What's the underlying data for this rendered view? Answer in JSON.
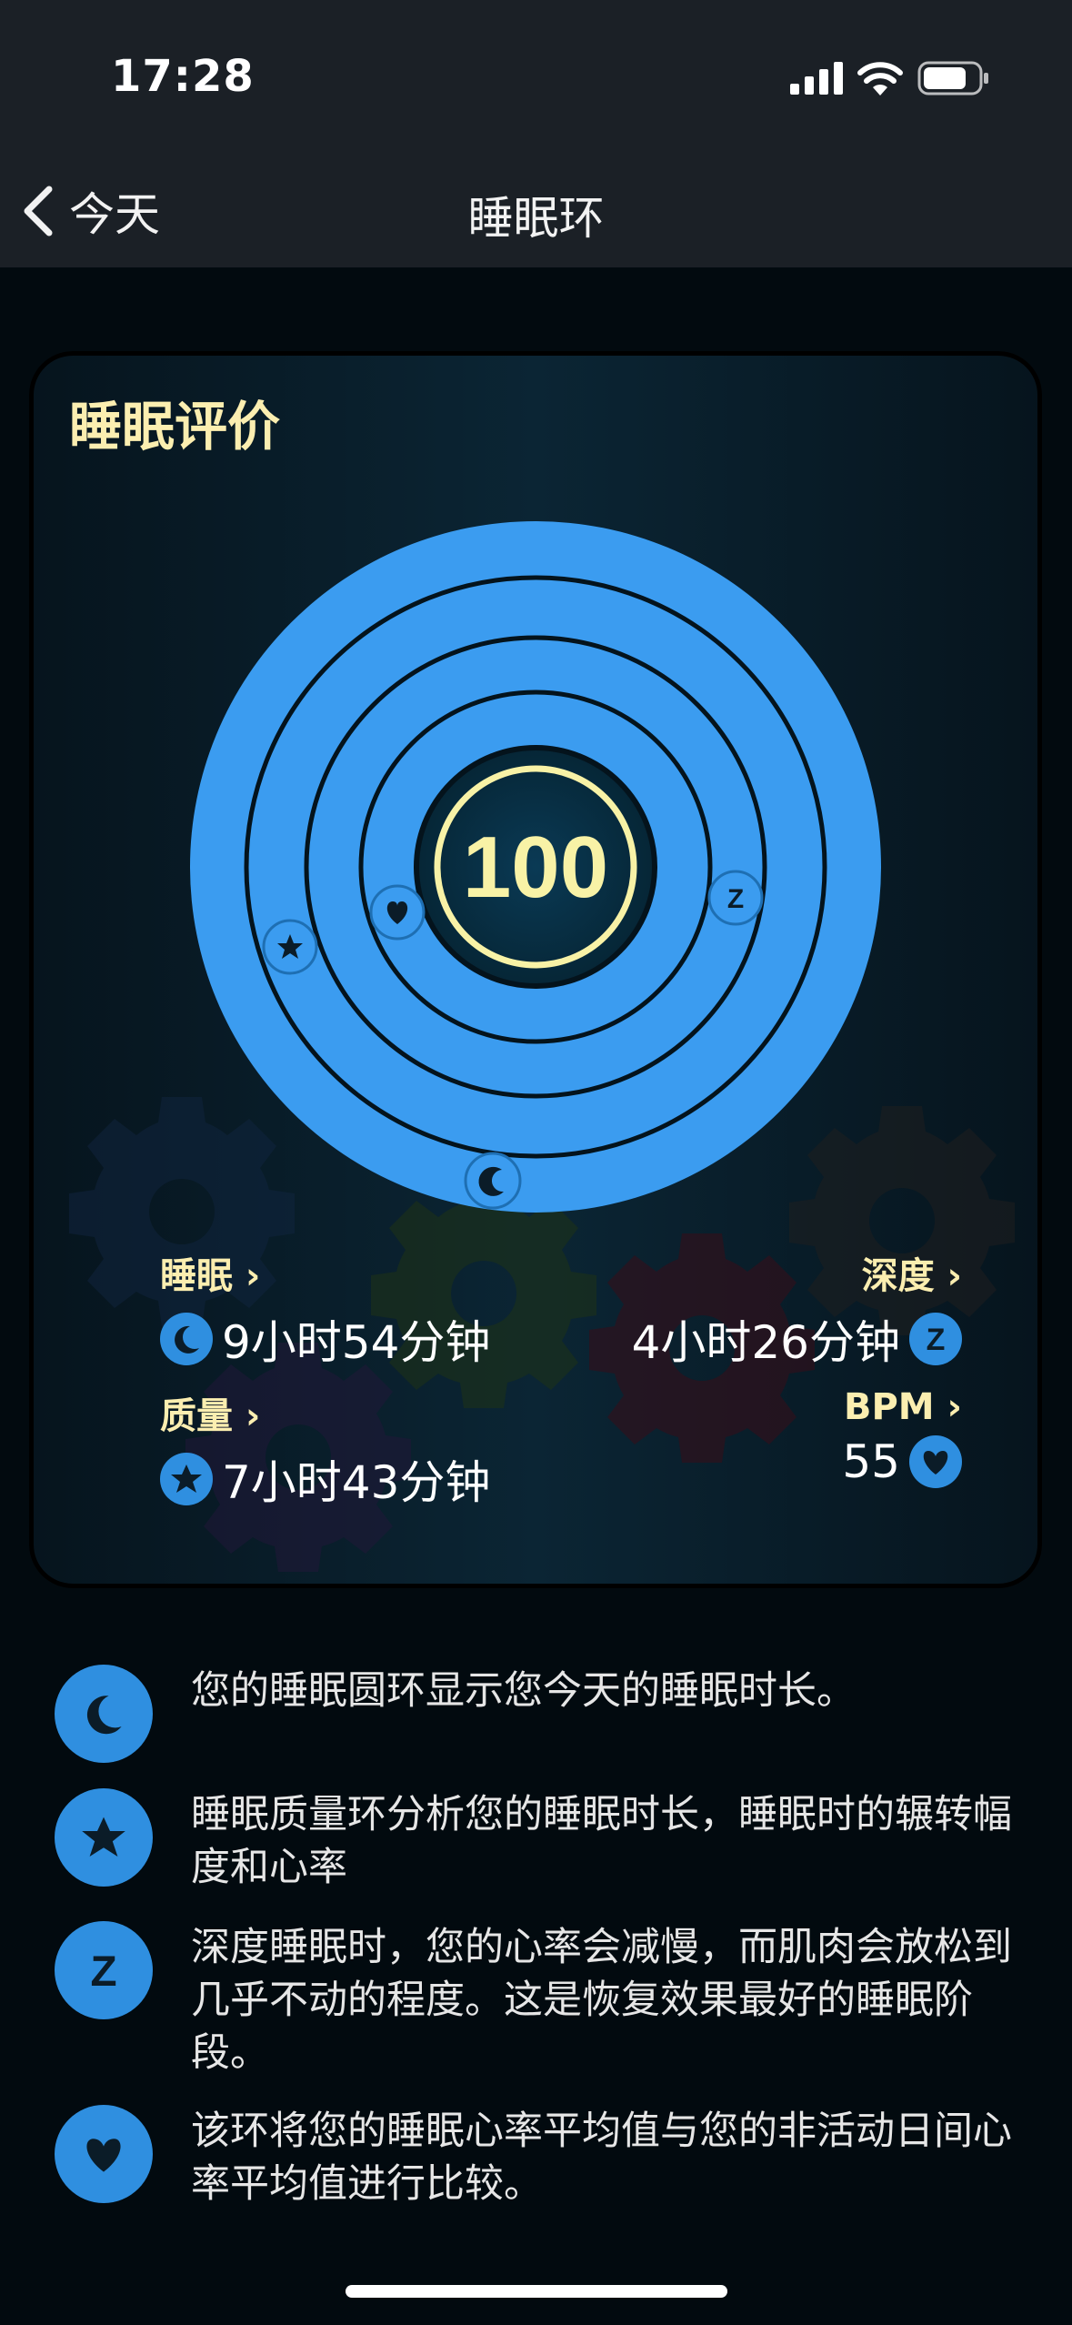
{
  "status": {
    "time": "17:28"
  },
  "nav": {
    "back_label": "今天",
    "title": "睡眠环"
  },
  "card": {
    "title": "睡眠评价",
    "score": "100",
    "metrics": {
      "sleep": {
        "label": "睡眠 ›",
        "value": "9小时54分钟"
      },
      "depth": {
        "label": "深度 ›",
        "value": "4小时26分钟"
      },
      "quality": {
        "label": "质量 ›",
        "value": "7小时43分钟"
      },
      "bpm": {
        "label": "BPM ›",
        "value": "55"
      }
    }
  },
  "legend": [
    {
      "icon": "moon-icon",
      "text": "您的睡眠圆环显示您今天的睡眠时长。"
    },
    {
      "icon": "star-icon",
      "text": "睡眠质量环分析您的睡眠时长，睡眠时的辗转幅度和心率"
    },
    {
      "icon": "z-icon",
      "text": "深度睡眠时，您的心率会减慢，而肌肉会放松到几乎不动的程度。这是恢复效果最好的睡眠阶段。"
    },
    {
      "icon": "heart-icon",
      "text": "该环将您的睡眠心率平均值与您的非活动日间心率平均值进行比较。"
    }
  ],
  "colors": {
    "accent": "#2f8fe0",
    "ring": "#3b9cf0",
    "title": "#fbeeb0",
    "score_ring": "#f8f2a6"
  }
}
